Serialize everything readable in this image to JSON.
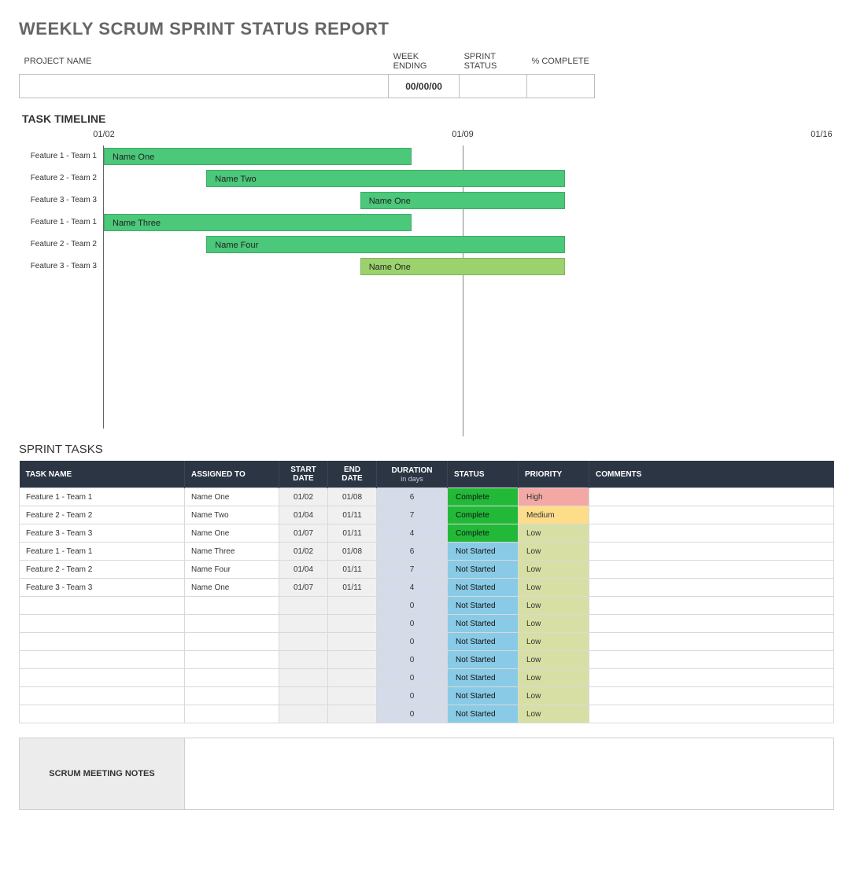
{
  "title": "WEEKLY SCRUM SPRINT STATUS REPORT",
  "header": {
    "labels": {
      "project_name": "PROJECT NAME",
      "week_ending": "WEEK ENDING",
      "sprint_status": "SPRINT STATUS",
      "pct_complete": "% COMPLETE"
    },
    "values": {
      "project_name": "",
      "week_ending": "00/00/00",
      "sprint_status": "",
      "pct_complete": ""
    }
  },
  "sections": {
    "timeline": "TASK TIMELINE",
    "sprint_tasks": "SPRINT TASKS",
    "notes": "SCRUM MEETING NOTES"
  },
  "chart_data": {
    "type": "bar",
    "orientation": "horizontal_gantt",
    "x_ticks": [
      "01/02",
      "01/09",
      "01/16"
    ],
    "x_range_days": [
      0,
      14
    ],
    "rows": [
      {
        "label": "Feature 1 - Team 1",
        "bar_label": "Name One",
        "start_day": 0,
        "end_day": 6,
        "color": "green1"
      },
      {
        "label": "Feature 2 - Team 2",
        "bar_label": "Name Two",
        "start_day": 2,
        "end_day": 9,
        "color": "green1"
      },
      {
        "label": "Feature 3 - Team 3",
        "bar_label": "Name One",
        "start_day": 5,
        "end_day": 9,
        "color": "green1"
      },
      {
        "label": "Feature 1 - Team 1",
        "bar_label": "Name Three",
        "start_day": 0,
        "end_day": 6,
        "color": "green1"
      },
      {
        "label": "Feature 2 - Team 2",
        "bar_label": "Name Four",
        "start_day": 2,
        "end_day": 9,
        "color": "green1"
      },
      {
        "label": "Feature 3 - Team 3",
        "bar_label": "Name One",
        "start_day": 5,
        "end_day": 9,
        "color": "green2"
      }
    ]
  },
  "tasks": {
    "headers": {
      "task_name": "TASK NAME",
      "assigned_to": "ASSIGNED TO",
      "start_date": "START DATE",
      "end_date": "END DATE",
      "duration": "DURATION",
      "duration_sub": "in days",
      "status": "STATUS",
      "priority": "PRIORITY",
      "comments": "COMMENTS"
    },
    "rows": [
      {
        "task": "Feature 1 - Team 1",
        "assigned": "Name One",
        "start": "01/02",
        "end": "01/08",
        "duration": "6",
        "status": "Complete",
        "priority": "High",
        "comments": ""
      },
      {
        "task": "Feature 2 - Team 2",
        "assigned": "Name Two",
        "start": "01/04",
        "end": "01/11",
        "duration": "7",
        "status": "Complete",
        "priority": "Medium",
        "comments": ""
      },
      {
        "task": "Feature 3 - Team 3",
        "assigned": "Name One",
        "start": "01/07",
        "end": "01/11",
        "duration": "4",
        "status": "Complete",
        "priority": "Low",
        "comments": ""
      },
      {
        "task": "Feature 1 - Team 1",
        "assigned": "Name Three",
        "start": "01/02",
        "end": "01/08",
        "duration": "6",
        "status": "Not Started",
        "priority": "Low",
        "comments": ""
      },
      {
        "task": "Feature 2 - Team 2",
        "assigned": "Name Four",
        "start": "01/04",
        "end": "01/11",
        "duration": "7",
        "status": "Not Started",
        "priority": "Low",
        "comments": ""
      },
      {
        "task": "Feature 3 - Team 3",
        "assigned": "Name One",
        "start": "01/07",
        "end": "01/11",
        "duration": "4",
        "status": "Not Started",
        "priority": "Low",
        "comments": ""
      },
      {
        "task": "",
        "assigned": "",
        "start": "",
        "end": "",
        "duration": "0",
        "status": "Not Started",
        "priority": "Low",
        "comments": ""
      },
      {
        "task": "",
        "assigned": "",
        "start": "",
        "end": "",
        "duration": "0",
        "status": "Not Started",
        "priority": "Low",
        "comments": ""
      },
      {
        "task": "",
        "assigned": "",
        "start": "",
        "end": "",
        "duration": "0",
        "status": "Not Started",
        "priority": "Low",
        "comments": ""
      },
      {
        "task": "",
        "assigned": "",
        "start": "",
        "end": "",
        "duration": "0",
        "status": "Not Started",
        "priority": "Low",
        "comments": ""
      },
      {
        "task": "",
        "assigned": "",
        "start": "",
        "end": "",
        "duration": "0",
        "status": "Not Started",
        "priority": "Low",
        "comments": ""
      },
      {
        "task": "",
        "assigned": "",
        "start": "",
        "end": "",
        "duration": "0",
        "status": "Not Started",
        "priority": "Low",
        "comments": ""
      },
      {
        "task": "",
        "assigned": "",
        "start": "",
        "end": "",
        "duration": "0",
        "status": "Not Started",
        "priority": "Low",
        "comments": ""
      }
    ]
  },
  "notes_content": ""
}
